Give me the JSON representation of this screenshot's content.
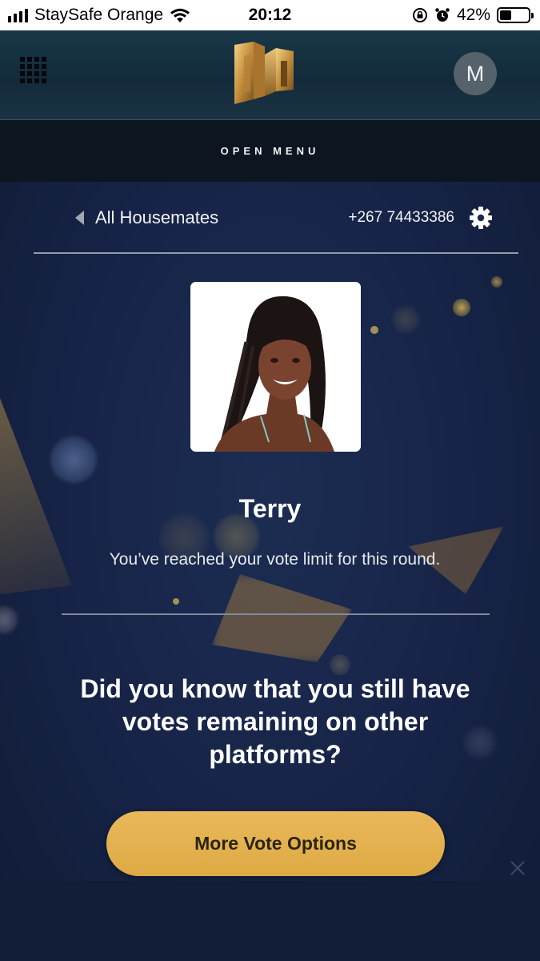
{
  "status_bar": {
    "carrier": "StaySafe Orange",
    "time": "20:12",
    "battery_percent": "42%",
    "battery_level": 0.42,
    "icons": [
      "signal-bars-icon",
      "wifi-icon",
      "rotation-lock-icon",
      "alarm-icon",
      "battery-icon"
    ]
  },
  "header": {
    "logo_icon": "dstv-logo-icon",
    "menu_icon": "apps-grid-icon",
    "avatar_initial": "M"
  },
  "menu_bar": {
    "label": "OPEN MENU"
  },
  "nav": {
    "back_label": "All Housemates",
    "phone": "+267 74433386",
    "settings_icon": "gear-icon"
  },
  "housemate": {
    "name": "Terry",
    "vote_message": "You’ve reached your vote limit for this round."
  },
  "promo": {
    "headline": "Did you know that you still have votes remaining on other platforms?",
    "button_label": "More Vote Options"
  },
  "colors": {
    "background": "#172448",
    "accent_gold": "#e3b04e",
    "menu_bar": "#0d1521"
  }
}
